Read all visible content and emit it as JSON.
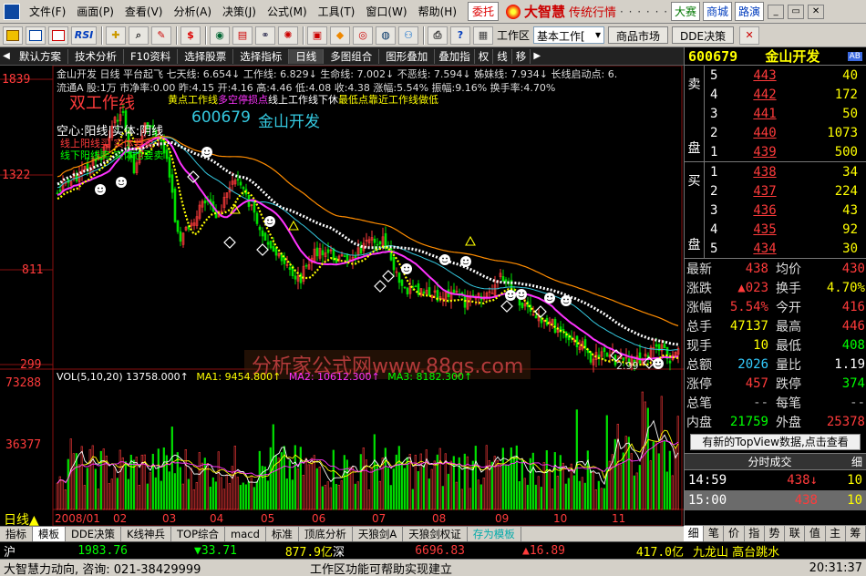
{
  "menu": {
    "items": [
      "文件(F)",
      "画面(P)",
      "查看(V)",
      "分析(A)",
      "决策(J)",
      "公式(M)",
      "工具(T)",
      "窗口(W)",
      "帮助(H)"
    ],
    "entrust": "委托",
    "brand": "大智慧",
    "brand_sub": "传统行情",
    "buttons": [
      "大赛",
      "商城",
      "路演"
    ]
  },
  "toolbar": {
    "rsi_label": "RSI",
    "money_label": "$",
    "workzone_label": "工作区",
    "workzone_select": "基本工作[",
    "market_btn": "商品市场",
    "dde_btn": "DDE决策"
  },
  "tabs": {
    "items": [
      "默认方案",
      "技术分析",
      "F10资料",
      "选择股票",
      "选择指标",
      "日线",
      "多图组合",
      "图形叠加",
      "叠加指",
      "权",
      "线",
      "移"
    ]
  },
  "chart": {
    "indicator_line": "金山开发 日线  平台起飞  七天线: 6.654↓  工作线: 6.829↓  生命线: 7.002↓  不恶线: 7.594↓  姊妹线: 7.934↓  长线启动点: 6.",
    "info_line": "流通A 股:1万 市净率:0.00 昨:4.15 开:4.16 高:4.46 低:4.08 收:4.38 涨幅:5.54% 振幅:9.16% 换手率:4.70%",
    "title_overlay": "双工作线",
    "yellow_note": "黄点工作线",
    "note_stoploss": "多空停损点",
    "note_work": "线上工作",
    "note_line2": "线下休",
    "note_low": "最低点靠近工作线做低",
    "stock_code": "600679",
    "stock_name": "金山开发",
    "hollow": "空心:阳线|实体:阴线",
    "red_note1": "线上阳线买 实体",
    "red_note1b": "要卖",
    "green_note1": "线下阳线卖 实体",
    "green_note1b": "也要卖",
    "watermark": "分析家公式网www.88gs.com",
    "low_label": "2.99",
    "price_labels": [
      "1839",
      "1322",
      "811",
      "299"
    ],
    "vol_line_prefix": "VOL(5,10,20)  13758.000↑",
    "ma1": "MA1: 9454.800↑",
    "ma2": "MA2: 10612.300↑",
    "ma3": "MA3: 8182.300↑",
    "vol_labels": [
      "73288",
      "36377"
    ],
    "period_label": "日线",
    "xticks": [
      "2008/01",
      "02",
      "03",
      "04",
      "05",
      "06",
      "07",
      "08",
      "09",
      "10",
      "11"
    ]
  },
  "bottom_tabs": [
    "指标",
    "模板",
    "DDE决策",
    "K线神兵",
    "TOP综合",
    "macd",
    "标准",
    "顶底分析",
    "天狼剑A",
    "天狼剑权证",
    "存为模板"
  ],
  "quote": {
    "code": "600679",
    "name": "金山开发",
    "ab_badge": "AB",
    "sell_side": "卖\n\n盘",
    "buy_side": "买\n\n盘",
    "asks": [
      {
        "level": "5",
        "price": "443",
        "vol": "40"
      },
      {
        "level": "4",
        "price": "442",
        "vol": "172"
      },
      {
        "level": "3",
        "price": "441",
        "vol": "50"
      },
      {
        "level": "2",
        "price": "440",
        "vol": "1073"
      },
      {
        "level": "1",
        "price": "439",
        "vol": "500"
      }
    ],
    "bids": [
      {
        "level": "1",
        "price": "438",
        "vol": "34"
      },
      {
        "level": "2",
        "price": "437",
        "vol": "224"
      },
      {
        "level": "3",
        "price": "436",
        "vol": "43"
      },
      {
        "level": "4",
        "price": "435",
        "vol": "92"
      },
      {
        "level": "5",
        "price": "434",
        "vol": "30"
      }
    ],
    "stats": [
      {
        "l1": "最新",
        "v1": "438",
        "c1": "r",
        "l2": "均价",
        "v2": "430",
        "c2": "r"
      },
      {
        "l1": "涨跌",
        "v1": "▲023",
        "c1": "r",
        "l2": "换手",
        "v2": "4.70%",
        "c2": "y"
      },
      {
        "l1": "涨幅",
        "v1": "5.54%",
        "c1": "r",
        "l2": "今开",
        "v2": "416",
        "c2": "r"
      },
      {
        "l1": "总手",
        "v1": "47137",
        "c1": "y",
        "l2": "最高",
        "v2": "446",
        "c2": "r"
      },
      {
        "l1": "现手",
        "v1": "10",
        "c1": "y",
        "l2": "最低",
        "v2": "408",
        "c2": "g"
      },
      {
        "l1": "总额",
        "v1": "2026",
        "c1": "c",
        "l2": "量比",
        "v2": "1.19",
        "c2": "w"
      },
      {
        "l1": "涨停",
        "v1": "457",
        "c1": "r",
        "l2": "跌停",
        "v2": "374",
        "c2": "g"
      },
      {
        "l1": "总笔",
        "v1": "--",
        "c1": "gr",
        "l2": "每笔",
        "v2": "--",
        "c2": "gr"
      },
      {
        "l1": "内盘",
        "v1": "21759",
        "c1": "g",
        "l2": "外盘",
        "v2": "25378",
        "c2": "r"
      }
    ],
    "topview_notice": "有新的TopView数据,点击查看",
    "ticks_title": "分时成交",
    "ticks_right": "细",
    "ticks": [
      {
        "time": "14:59",
        "price": "438↓",
        "vol": "10"
      },
      {
        "time": "15:00",
        "price": "438",
        "vol": "10"
      }
    ],
    "panel_tabs": [
      "细",
      "笔",
      "价",
      "指",
      "势",
      "联",
      "值",
      "主",
      "筹"
    ]
  },
  "indexbar": {
    "sh_label": "沪",
    "sh_value": "1983.76",
    "sh_change": "▼33.71",
    "sh_amount": "877.9亿",
    "sz_label": "深",
    "sz_value": "6696.83",
    "sz_change": "▲16.89",
    "sz_amount": "417.0亿",
    "news": "九龙山  高台跳水"
  },
  "status": {
    "left": "大智慧力动向, 咨询: 021-38429999",
    "center": "工作区功能可帮助实现建立",
    "time": "20:31:37"
  },
  "colors": {
    "up": "#ff3b3b",
    "down": "#00e000",
    "ma_orange": "#ff8c00",
    "ma_magenta": "#ff33ff",
    "ma_cyan": "#35c9e0",
    "ma_white": "#ffffff",
    "work_yellow": "#ffff00"
  }
}
